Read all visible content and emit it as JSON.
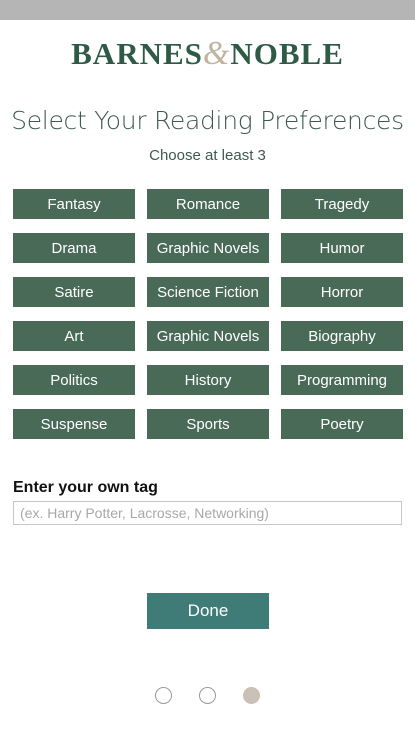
{
  "header": {
    "logo_left": "BARNES",
    "logo_amp": "&",
    "logo_right": "NOBLE"
  },
  "title": "Select Your Reading Preferences",
  "subtitle": "Choose at least 3",
  "tags": [
    "Fantasy",
    "Romance",
    "Tragedy",
    "Drama",
    "Graphic Novels",
    "Humor",
    "Satire",
    "Science Fiction",
    "Horror",
    "Art",
    "Graphic Novels",
    "Biography",
    "Politics",
    "History",
    "Programming",
    "Suspense",
    "Sports",
    "Poetry"
  ],
  "own_tag": {
    "label": "Enter your own tag",
    "placeholder": "(ex. Harry Potter, Lacrosse, Networking)",
    "value": ""
  },
  "done_label": "Done",
  "pager": {
    "count": 3,
    "active_index": 2
  },
  "colors": {
    "brand_green": "#2f5a47",
    "tag_bg": "#4a6a58",
    "done_bg": "#3f7c78",
    "ampersand": "#bfb49e",
    "status_bar": "#b5b5b5"
  }
}
